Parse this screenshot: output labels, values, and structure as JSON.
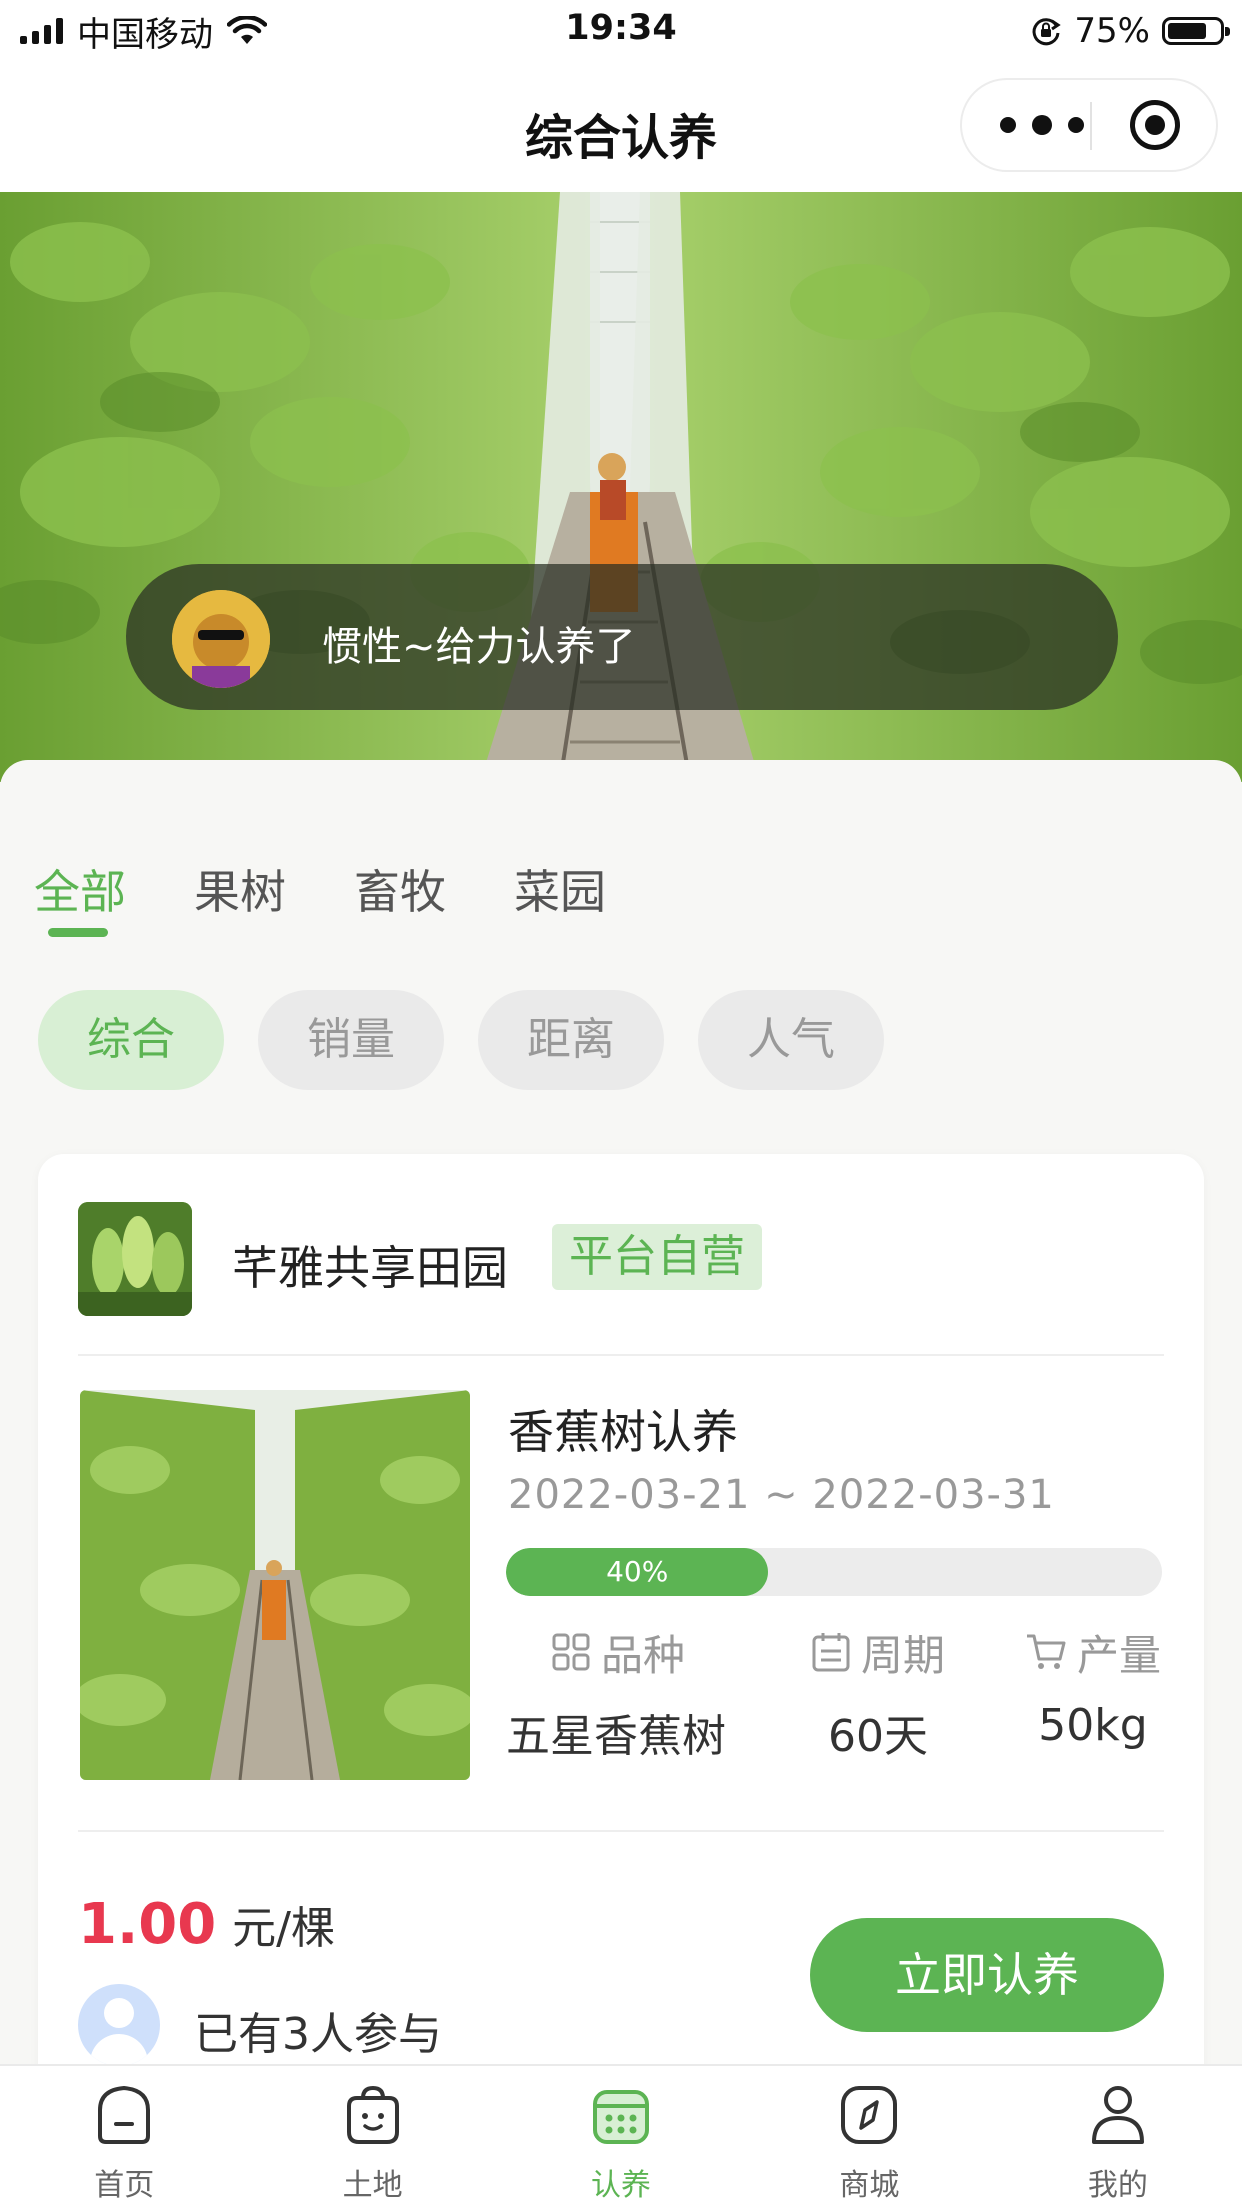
{
  "status_bar": {
    "carrier": "中国移动",
    "time": "19:34",
    "battery_pct": "75%"
  },
  "nav": {
    "title": "综合认养"
  },
  "hero": {
    "notice_text": "惯性~给力认养了"
  },
  "category_tabs": [
    {
      "label": "全部",
      "active": true
    },
    {
      "label": "果树",
      "active": false
    },
    {
      "label": "畜牧",
      "active": false
    },
    {
      "label": "菜园",
      "active": false
    }
  ],
  "sort_chips": [
    {
      "label": "综合",
      "active": true
    },
    {
      "label": "销量",
      "active": false
    },
    {
      "label": "距离",
      "active": false
    },
    {
      "label": "人气",
      "active": false
    }
  ],
  "card": {
    "shop_name": "芊雅共享田园",
    "shop_badge": "平台自营",
    "product_title": "香蕉树认养",
    "date_range": "2022-03-21 ~ 2022-03-31",
    "progress": {
      "value": 0.4,
      "label": "40%"
    },
    "specs": {
      "variety": {
        "label": "品种",
        "value": "五星香蕉树",
        "icon": "grid-icon"
      },
      "period": {
        "label": "周期",
        "value": "60天",
        "icon": "calendar-icon"
      },
      "yield": {
        "label": "产量",
        "value": "50kg",
        "icon": "cart-icon"
      }
    },
    "price": {
      "amount": "1.00",
      "unit": "元/棵"
    },
    "participants_text": "已有3人参与",
    "cta_label": "立即认养"
  },
  "tab_bar": {
    "items": [
      {
        "label": "首页",
        "icon": "home-icon",
        "active": false
      },
      {
        "label": "土地",
        "icon": "bag-icon",
        "active": false
      },
      {
        "label": "认养",
        "icon": "calendar-grid-icon",
        "active": true
      },
      {
        "label": "商城",
        "icon": "compass-icon",
        "active": false
      },
      {
        "label": "我的",
        "icon": "person-icon",
        "active": false
      }
    ]
  },
  "colors": {
    "accent": "#5cb453",
    "price": "#e8384f",
    "badge_bg": "#dcefd8"
  }
}
